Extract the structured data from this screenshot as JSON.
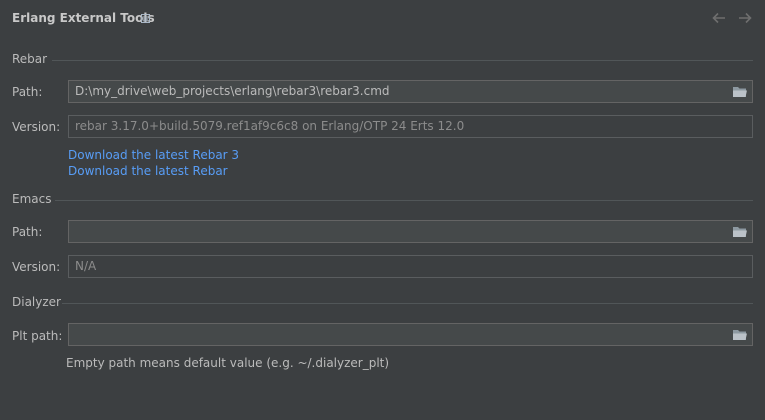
{
  "header": {
    "title": "Erlang External Tools"
  },
  "rebar": {
    "section": "Rebar",
    "path_label": "Path:",
    "path_value": "D:\\my_drive\\web_projects\\erlang\\rebar3\\rebar3.cmd",
    "version_label": "Version:",
    "version_value": "rebar 3.17.0+build.5079.ref1af9c6c8 on Erlang/OTP 24 Erts 12.0",
    "link_rebar3": "Download the latest Rebar 3",
    "link_rebar": "Download the latest Rebar"
  },
  "emacs": {
    "section": "Emacs",
    "path_label": "Path:",
    "path_value": "",
    "version_label": "Version:",
    "version_value": "N/A"
  },
  "dialyzer": {
    "section": "Dialyzer",
    "plt_label": "Plt path:",
    "plt_value": "",
    "hint": "Empty path means default value (e.g. ~/.dialyzer_plt)"
  },
  "colors": {
    "background": "#3c3f41",
    "link": "#589df6",
    "text": "#bbbbbb"
  },
  "icons": [
    "settings-menu-icon",
    "back-arrow-icon",
    "forward-arrow-icon",
    "folder-icon"
  ]
}
